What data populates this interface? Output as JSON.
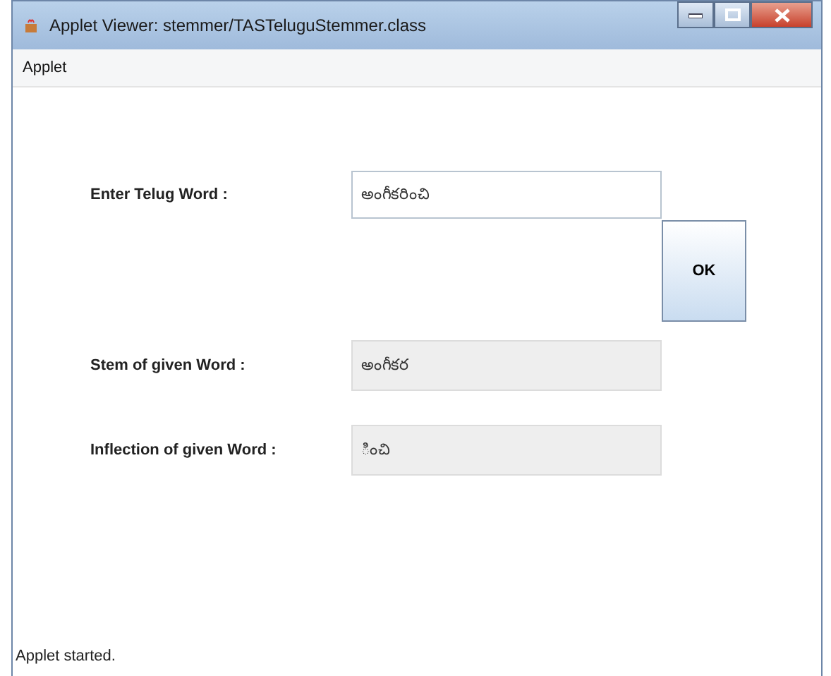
{
  "window": {
    "title": "Applet Viewer: stemmer/TASTeluguStemmer.class"
  },
  "menu": [
    "Applet"
  ],
  "form": [
    {
      "label": "Enter Telug Word :",
      "value": "అంగీకరించి",
      "editable": true
    },
    {
      "label": "Stem of given Word :",
      "value": "అంగీకర",
      "editable": false
    },
    {
      "label": "Inflection of given Word :",
      "value": "ించి",
      "editable": false
    }
  ],
  "button": "OK",
  "status_bar": "Applet started."
}
